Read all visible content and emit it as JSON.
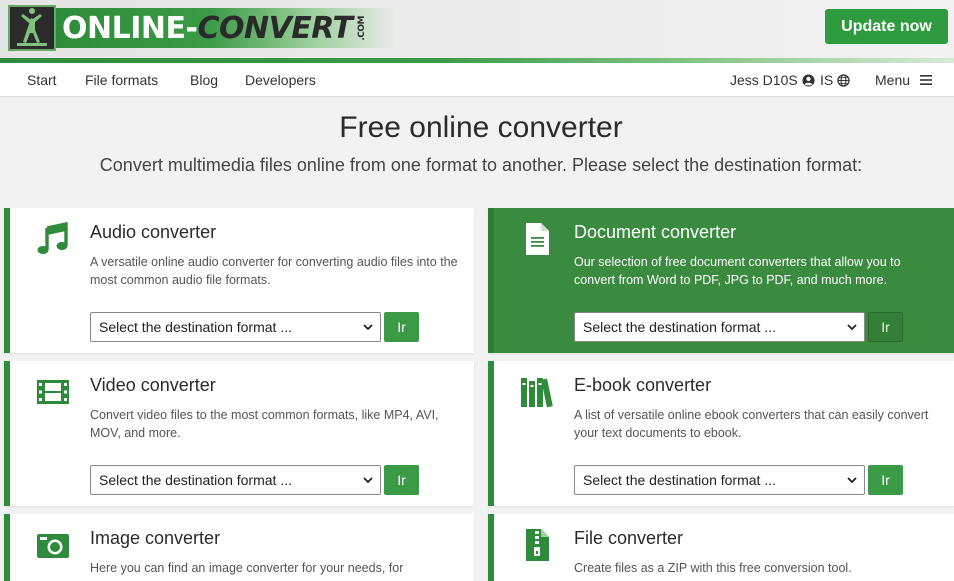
{
  "header": {
    "logo_online": "ONLINE",
    "logo_dash": "-",
    "logo_convert": "CONVERT",
    "logo_com": ".COM",
    "update_button": "Update now",
    "accent": "#2e9c3e"
  },
  "nav": {
    "items": [
      "Start",
      "File formats",
      "Blog",
      "Developers"
    ],
    "user": "Jess D10S",
    "language": "IS",
    "menu": "Menu"
  },
  "hero": {
    "title": "Free online converter",
    "subtitle": "Convert multimedia files online from one format to another. Please select the destination format:"
  },
  "cards": [
    {
      "icon": "music-note-icon",
      "title": "Audio converter",
      "desc": "A versatile online audio converter for converting audio files into the most common audio file formats.",
      "select": "Select the destination format ...",
      "go": "Ir"
    },
    {
      "icon": "document-icon",
      "title": "Document converter",
      "desc": "Our selection of free document converters that allow you to convert from Word to PDF, JPG to PDF, and much more.",
      "select": "Select the destination format ...",
      "go": "Ir"
    },
    {
      "icon": "film-icon",
      "title": "Video converter",
      "desc": "Convert video files to the most common formats, like MP4, AVI, MOV, and more.",
      "select": "Select the destination format ...",
      "go": "Ir"
    },
    {
      "icon": "books-icon",
      "title": "E-book converter",
      "desc": "A list of versatile online ebook converters that can easily convert your text documents to ebook.",
      "select": "Select the destination format ...",
      "go": "Ir"
    },
    {
      "icon": "camera-icon",
      "title": "Image converter",
      "desc": "Here you can find an image converter for your needs, for",
      "select": "",
      "go": ""
    },
    {
      "icon": "zip-file-icon",
      "title": "File converter",
      "desc": "Create files as a ZIP with this free conversion tool.",
      "select": "",
      "go": ""
    }
  ],
  "colors": {
    "green": "#2e8b3b",
    "active_card": "#3a8a3f",
    "background": "#f2f2f2"
  }
}
